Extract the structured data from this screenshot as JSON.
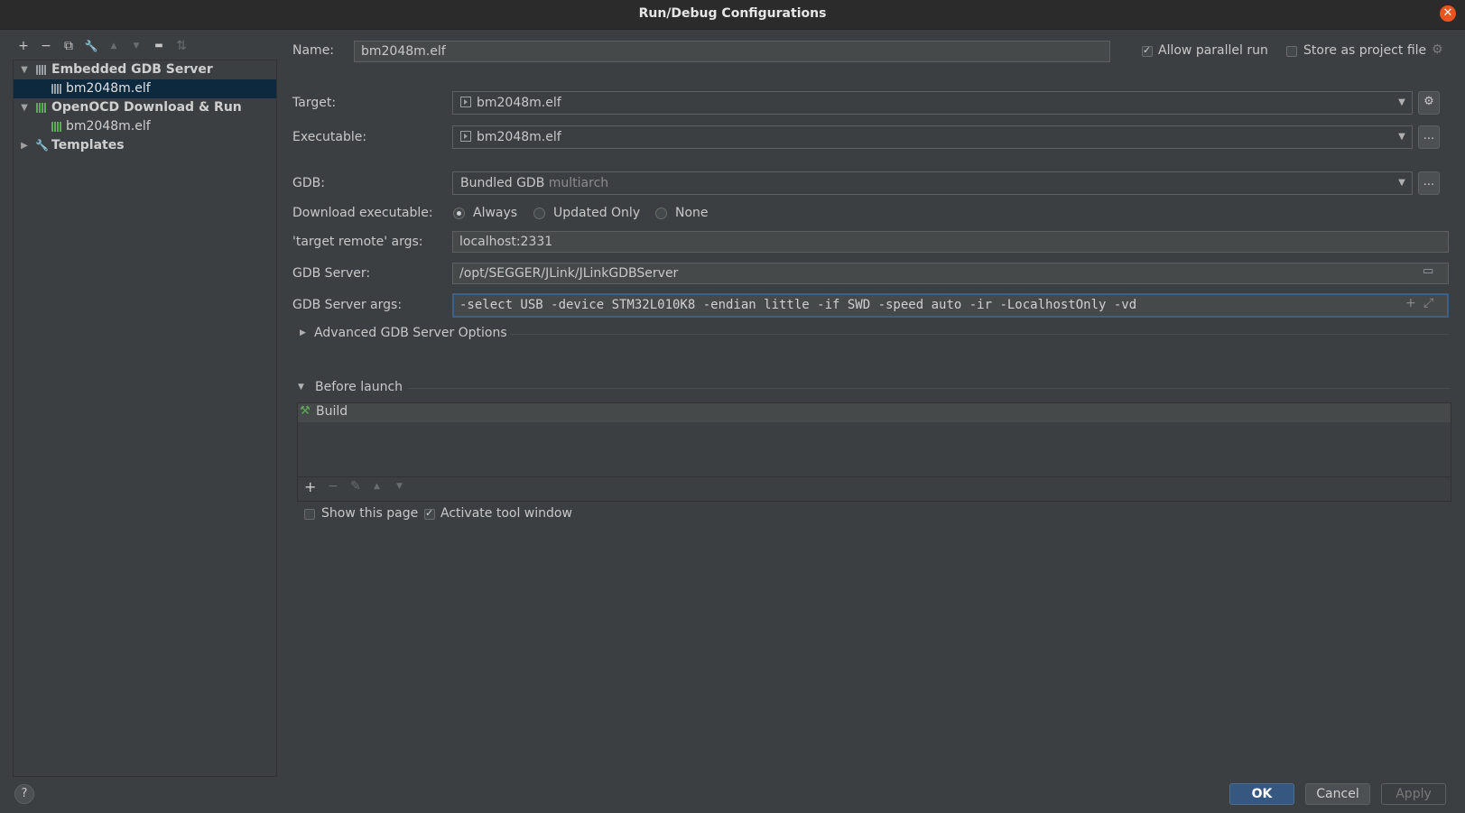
{
  "window": {
    "title": "Run/Debug Configurations",
    "close_glyph": "✕"
  },
  "toolbar": {
    "add": "+",
    "remove": "−",
    "copy": "⧉",
    "edit": "🔧",
    "up": "▲",
    "down": "▼",
    "folder": "▬",
    "sort": "⇅"
  },
  "tree": {
    "groups": [
      {
        "label": "Embedded GDB Server",
        "expanded": true,
        "children": [
          "bm2048m.elf"
        ]
      },
      {
        "label": "OpenOCD Download & Run",
        "expanded": true,
        "children": [
          "bm2048m.elf"
        ]
      },
      {
        "label": "Templates",
        "expanded": false
      }
    ],
    "selected": "bm2048m.elf"
  },
  "form": {
    "name_label": "Name:",
    "name_value": "bm2048m.elf",
    "allow_parallel_label": "Allow parallel run",
    "allow_parallel_checked": true,
    "store_project_label": "Store as project file",
    "store_project_checked": false,
    "target_label": "Target:",
    "target_value": "bm2048m.elf",
    "executable_label": "Executable:",
    "executable_value": "bm2048m.elf",
    "gdb_label": "GDB:",
    "gdb_value": "Bundled GDB",
    "gdb_suffix": "multiarch",
    "download_label": "Download executable:",
    "download_options": [
      "Always",
      "Updated Only",
      "None"
    ],
    "download_selected": "Always",
    "target_remote_label": "'target remote' args:",
    "target_remote_value": "localhost:2331",
    "gdb_server_label": "GDB Server:",
    "gdb_server_value": "/opt/SEGGER/JLink/JLinkGDBServer",
    "gdb_server_args_label": "GDB Server args:",
    "gdb_server_args_value": "-select USB -device STM32L010K8 -endian little -if SWD -speed auto -ir -LocalhostOnly -vd",
    "advanced_label": "Advanced GDB Server Options",
    "ellipsis": "..."
  },
  "before_launch": {
    "title": "Before launch",
    "items": [
      "Build"
    ],
    "tools": {
      "add": "+",
      "remove": "−",
      "edit": "✎",
      "up": "▲",
      "down": "▼"
    },
    "show_page_label": "Show this page",
    "show_page_checked": false,
    "activate_label": "Activate tool window",
    "activate_checked": true
  },
  "footer": {
    "help": "?",
    "ok": "OK",
    "cancel": "Cancel",
    "apply": "Apply"
  },
  "colors": {
    "accent": "#365880",
    "focus": "#3d6185",
    "close": "#e95420",
    "selection": "#0d293e"
  }
}
